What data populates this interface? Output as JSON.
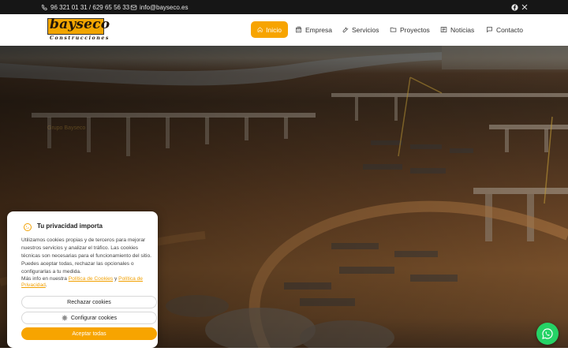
{
  "topbar": {
    "phone_text": "96 321 01 31 / 629 65 56 33",
    "email_text": "info@bayseco.es",
    "social": [
      "facebook-icon",
      "x-icon"
    ]
  },
  "header": {
    "logo": {
      "brand": "bayseco",
      "tagline": "Construcciones"
    },
    "nav": [
      {
        "label": "Inicio",
        "icon": "home-icon",
        "active": true
      },
      {
        "label": "Empresa",
        "icon": "building-icon"
      },
      {
        "label": "Servicios",
        "icon": "wrench-icon"
      },
      {
        "label": "Proyectos",
        "icon": "folder-icon"
      },
      {
        "label": "Noticias",
        "icon": "newspaper-icon"
      },
      {
        "label": "Contacto",
        "icon": "chat-icon"
      }
    ]
  },
  "hero": {
    "ghost_text": "Grupo Bayseco"
  },
  "cookie_banner": {
    "title": "Tu privacidad importa",
    "body": "Utilizamos cookies propias y de terceros para mejorar nuestros servicios y analizar el tráfico. Las cookies técnicas son necesarias para el funcionamiento del sitio. Puedes aceptar todas, rechazar las opcionales o configurarlas a tu medida.",
    "more_prefix": "Más info en nuestra ",
    "cookie_policy_link": "Política de Cookies",
    "and": " y ",
    "privacy_policy_link": "Política de Privacidad",
    "period": ".",
    "reject_label": "Rechazar cookies",
    "configure_label": "Configurar cookies",
    "accept_label": "Aceptar todas"
  },
  "colors": {
    "accent": "#f7a400",
    "topbar": "#161616",
    "whatsapp": "#25d366"
  }
}
